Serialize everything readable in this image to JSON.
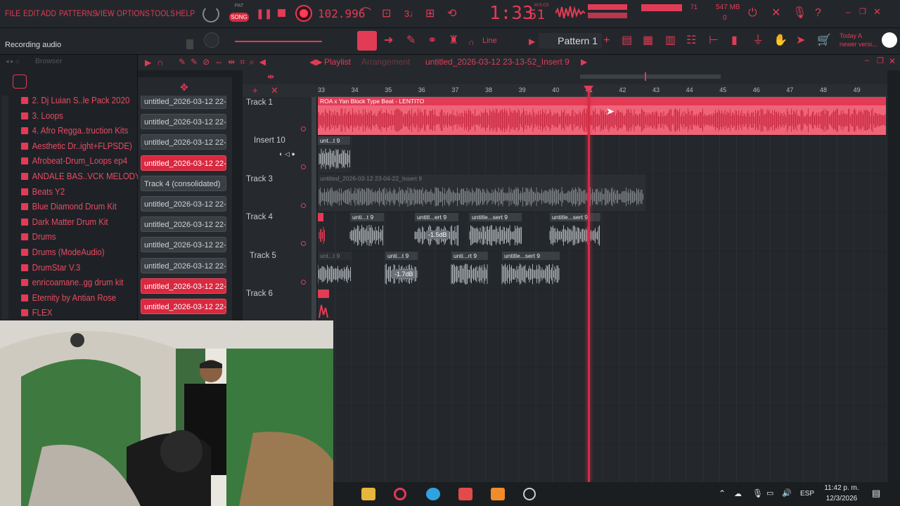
{
  "menu": [
    "FILE",
    "EDIT",
    "ADD",
    "PATTERNS",
    "VIEW",
    "OPTIONS",
    "TOOLS",
    "HELP"
  ],
  "transport": {
    "mode_top": "PAT",
    "mode_bottom": "SONG",
    "tempo": "102.996",
    "time_main": "1:33",
    "time_sub": "51",
    "time_unit": "M:S:CS",
    "cpu_value": "71",
    "memory": "547 MB",
    "memory_sub": "0",
    "status": "Recording audio"
  },
  "toolbar": {
    "snap": "Line",
    "pattern": "Pattern 1",
    "news_line1": "Today  A",
    "news_line2": "newer versi..."
  },
  "browser": {
    "title": "Browser",
    "items": [
      "2. Dj Luian S..le Pack 2020",
      "3. Loops",
      "4. Afro Regga..truction Kits",
      "Aesthetic Dr..ight+FLPSDE)",
      "Afrobeat-Drum_Loops ep4",
      "ANDALE BAS..VCK MELODY",
      "Beats Y2",
      "Blue Diamond Drum Kit",
      "Dark Matter Drum Kit",
      "Drums",
      "Drums (ModeAudio)",
      "DrumStar V.3",
      "enricoamane..gg drum kit",
      "Eternity by Antian Rose",
      "FLEX"
    ]
  },
  "cliplist": [
    {
      "label": "untitled_2026-03-12 22-...",
      "selected": false
    },
    {
      "label": "untitled_2026-03-12 22-...",
      "selected": false
    },
    {
      "label": "untitled_2026-03-12 22-...",
      "selected": false
    },
    {
      "label": "untitled_2026-03-12 22-...",
      "selected": true
    },
    {
      "label": "Track 4 (consolidated)",
      "selected": false
    },
    {
      "label": "untitled_2026-03-12 22-...",
      "selected": false
    },
    {
      "label": "untitled_2026-03-12 22-...",
      "selected": false
    },
    {
      "label": "untitled_2026-03-12 22-...",
      "selected": false
    },
    {
      "label": "untitled_2026-03-12 22-...",
      "selected": false
    },
    {
      "label": "untitled_2026-03-12 22-...",
      "selected": true
    },
    {
      "label": "untitled_2026-03-12 22-...",
      "selected": true
    }
  ],
  "playlist": {
    "title": "Playlist",
    "subtitle": "Arrangement",
    "file": "untitled_2026-03-12 23-13-52_Insert 9",
    "ruler": [
      "33",
      "34",
      "35",
      "36",
      "37",
      "38",
      "39",
      "40",
      "41",
      "42",
      "43",
      "44",
      "45",
      "46",
      "47",
      "48",
      "49"
    ],
    "tracks": [
      "Track 1",
      "Insert 10",
      "Track 3",
      "Track 4",
      "Track 5",
      "Track 6"
    ],
    "clips": {
      "t1": "ROA x Yan Block Type Beat - LENTITO",
      "t2": "unt...t 9",
      "t3": "untitled_2026-03-12 23-04-22_Insert 9",
      "t4a": "unti...t 9",
      "t4b": "untitl...ert 9",
      "t4c": "untitle...sert 9",
      "t4d": "untitle...sert 9",
      "t4_gain": "-1.5dB",
      "t5a": "unt...t 9",
      "t5b": "unti...t 9",
      "t5c": "unti...rt 9",
      "t5d": "untitle...sert 9",
      "t5_gain": "-1.7dB"
    }
  },
  "taskbar": {
    "lang": "ESP",
    "time": "11:42 p. m.",
    "date": "12/3/2026"
  },
  "colors": {
    "accent": "#e23b56",
    "waveform": "#f06478",
    "clip_gray": "#a9aeb3"
  }
}
